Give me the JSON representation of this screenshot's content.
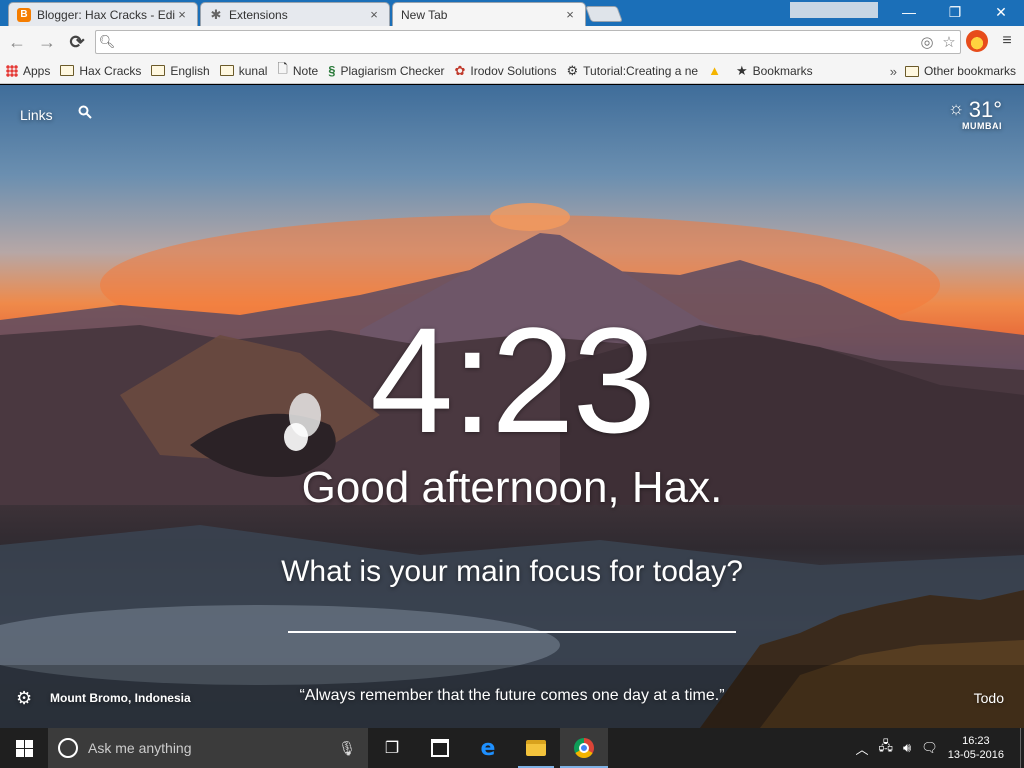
{
  "browser": {
    "tabs": [
      {
        "title": "Blogger: Hax Cracks - Edit",
        "favicon": "blogger-icon",
        "active": false
      },
      {
        "title": "Extensions",
        "favicon": "puzzle-icon",
        "active": false
      },
      {
        "title": "New Tab",
        "favicon": "",
        "active": true
      }
    ],
    "close_glyph": "×",
    "window_controls": {
      "minimize": "—",
      "restore": "❐",
      "close": "✕"
    },
    "omnibox": {
      "value": "",
      "placeholder": ""
    },
    "nav": {
      "back": "←",
      "forward": "→",
      "reload": "⟳",
      "menu": "≡"
    },
    "bookmarks": [
      {
        "label": "Apps",
        "icon": "apps-grid-icon"
      },
      {
        "label": "Hax Cracks",
        "icon": "folder-icon"
      },
      {
        "label": "English",
        "icon": "folder-icon"
      },
      {
        "label": "kunal",
        "icon": "folder-icon"
      },
      {
        "label": "Note",
        "icon": "page-icon"
      },
      {
        "label": "Plagiarism Checker",
        "icon": "s-logo-icon"
      },
      {
        "label": "Irodov Solutions",
        "icon": "swirl-icon"
      },
      {
        "label": "Tutorial:Creating a ne",
        "icon": "gear-logo-icon"
      },
      {
        "label": "",
        "icon": "drive-icon"
      },
      {
        "label": "Bookmarks",
        "icon": "star-icon"
      }
    ],
    "bookmarks_overflow": "»",
    "other_bookmarks": "Other bookmarks"
  },
  "momentum": {
    "links_label": "Links",
    "weather": {
      "temp": "31°",
      "city": "MUMBAI",
      "icon": "sun-icon"
    },
    "time": "4:23",
    "greeting": "Good afternoon, Hax.",
    "focus_question": "What is your main focus for today?",
    "focus_value": "",
    "location": "Mount Bromo, Indonesia",
    "quote": "“Always remember that the future comes one day at a time.”",
    "todo_label": "Todo"
  },
  "taskbar": {
    "search_placeholder": "Ask me anything",
    "clock_time": "16:23",
    "clock_date": "13-05-2016"
  },
  "colors": {
    "titlebar": "#1b6fb8",
    "toolbar": "#f5f5f5",
    "taskbar": "#1f1f1f",
    "accent": "#7fb2e5"
  }
}
